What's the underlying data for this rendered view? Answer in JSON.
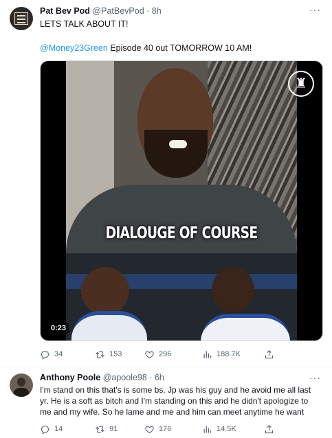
{
  "tweets": [
    {
      "author_name": "Pat Bev Pod",
      "handle": "@PatBevPod",
      "time": "8h",
      "line1": "LETS TALK ABOUT IT!",
      "mention": "@Money23Green",
      "line2_rest": " Episode 40 out TOMORROW 10 AM!",
      "media": {
        "caption": "DIALOUGE OF COURSE",
        "duration": "0:23"
      },
      "stats": {
        "replies": "34",
        "retweets": "153",
        "likes": "296",
        "views": "188.7K"
      }
    },
    {
      "author_name": "Anthony Poole",
      "handle": "@apoole98",
      "time": "6h",
      "text": "I'm stand on this that's is some bs. Jp was his guy and he avoid me all last yr. He is a soft as bitch and I'm standing on this and he didn't apologize to me and my wife. So he lame and me and him can meet anytime he want",
      "stats": {
        "replies": "14",
        "retweets": "91",
        "likes": "176",
        "views": "14.5K"
      }
    }
  ],
  "separator": "·",
  "more_label": "···",
  "icons": {
    "reply": "reply-icon",
    "retweet": "retweet-icon",
    "like": "heart-icon",
    "views": "views-icon",
    "share": "share-icon"
  },
  "colors": {
    "accent": "#1d9bf0",
    "muted": "#536471",
    "text": "#0f1419"
  }
}
